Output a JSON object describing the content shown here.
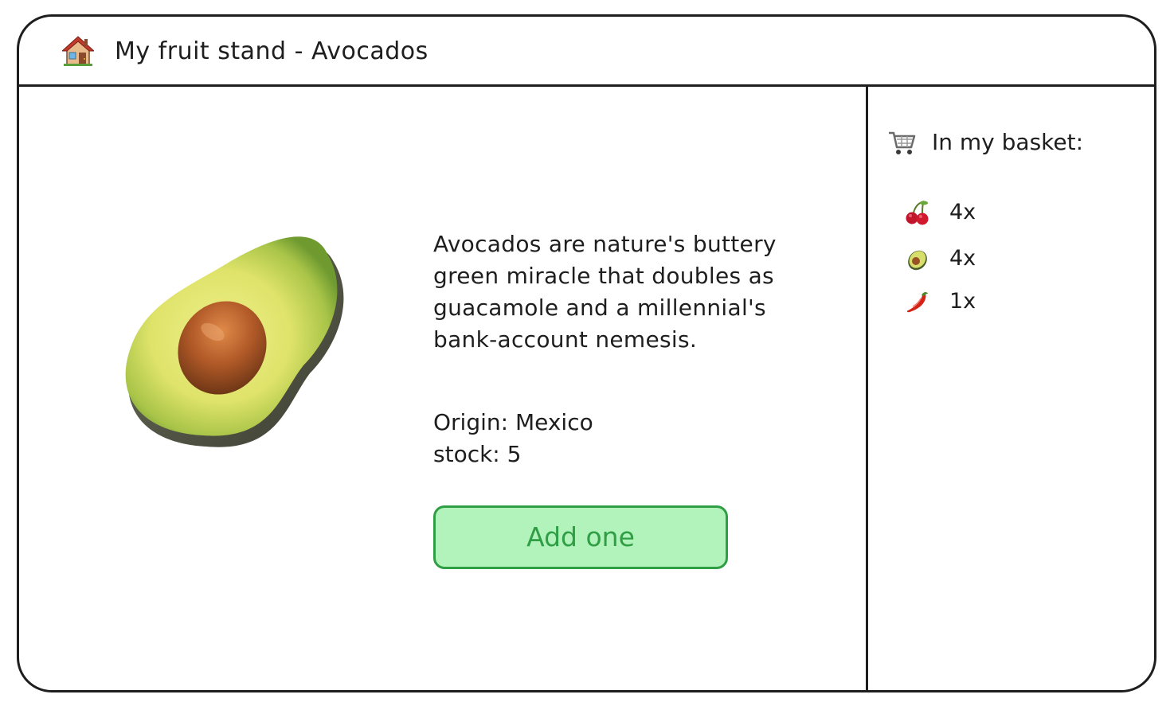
{
  "window": {
    "title": "My fruit stand - Avocados",
    "title_icon": "house-icon"
  },
  "product": {
    "name": "Avocados",
    "image_icon": "avocado-icon",
    "description": "Avocados are nature's buttery green miracle that doubles as guacamole and a millennial's bank-account nemesis.",
    "origin_text": "Origin: Mexico",
    "stock_text": "stock: 5",
    "add_button_label": "Add one"
  },
  "basket": {
    "title": "In my basket:",
    "icon": "shopping-cart-icon",
    "items": [
      {
        "icon": "cherries-icon",
        "quantity": "4x"
      },
      {
        "icon": "avocado-icon",
        "quantity": "4x"
      },
      {
        "icon": "chili-pepper-icon",
        "quantity": "1x"
      }
    ]
  },
  "colors": {
    "stroke": "#1e1e1e",
    "button_fill": "#b2f2bb",
    "button_stroke": "#2f9e44",
    "button_text": "#2f9e44"
  }
}
